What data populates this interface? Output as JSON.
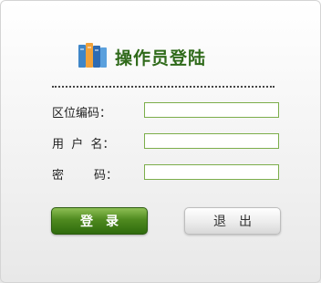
{
  "header": {
    "title": "操作员登陆",
    "logo_icon": "books-icon"
  },
  "form": {
    "area_code_label": "区位编码：",
    "username_label": "用  户  名：",
    "password_label": "密        码：",
    "area_code_value": "",
    "username_value": "",
    "password_value": ""
  },
  "buttons": {
    "login_label": "登录",
    "exit_label": "退出"
  },
  "colors": {
    "title": "#2f6a1a",
    "field_border": "#7cae4b",
    "login_button": "#4f8a1f"
  }
}
